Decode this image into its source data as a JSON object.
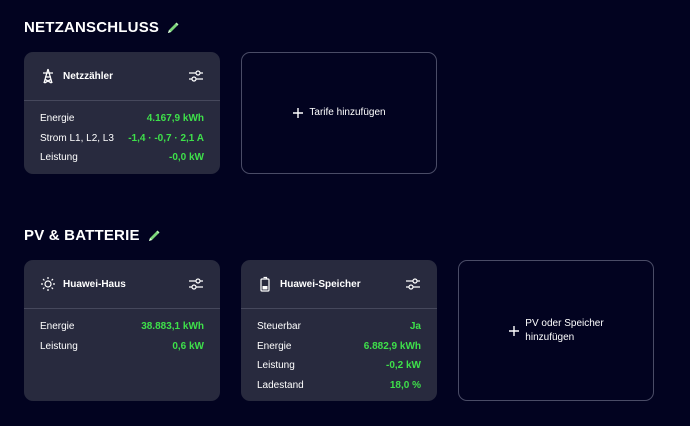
{
  "sections": {
    "grid": {
      "title": "NETZANSCHLUSS"
    },
    "pv": {
      "title": "PV & BATTERIE"
    }
  },
  "meter": {
    "title": "Netzzähler",
    "icon": "power-pylon-icon",
    "rows": [
      {
        "label": "Energie",
        "value": "4.167,9 kWh"
      },
      {
        "label": "Strom L1, L2, L3",
        "value": "-1,4 · -0,7 · 2,1 A"
      },
      {
        "label": "Leistung",
        "value": "-0,0 kW"
      }
    ]
  },
  "tariff_add": {
    "label": "Tarife hinzufügen"
  },
  "pv_house": {
    "title": "Huawei-Haus",
    "icon": "sun-icon",
    "rows": [
      {
        "label": "Energie",
        "value": "38.883,1 kWh"
      },
      {
        "label": "Leistung",
        "value": "0,6 kW"
      }
    ]
  },
  "battery": {
    "title": "Huawei-Speicher",
    "icon": "battery-icon",
    "rows": [
      {
        "label": "Steuerbar",
        "value": "Ja"
      },
      {
        "label": "Energie",
        "value": "6.882,9 kWh"
      },
      {
        "label": "Leistung",
        "value": "-0,2 kW"
      },
      {
        "label": "Ladestand",
        "value": "18,0 %"
      }
    ]
  },
  "pv_add": {
    "line1": "PV oder Speicher",
    "line2": "hinzufügen"
  },
  "colors": {
    "background": "#020320",
    "card": "#282a3e",
    "value_green": "#3ee04a",
    "pencil_green": "#7cd67a"
  }
}
